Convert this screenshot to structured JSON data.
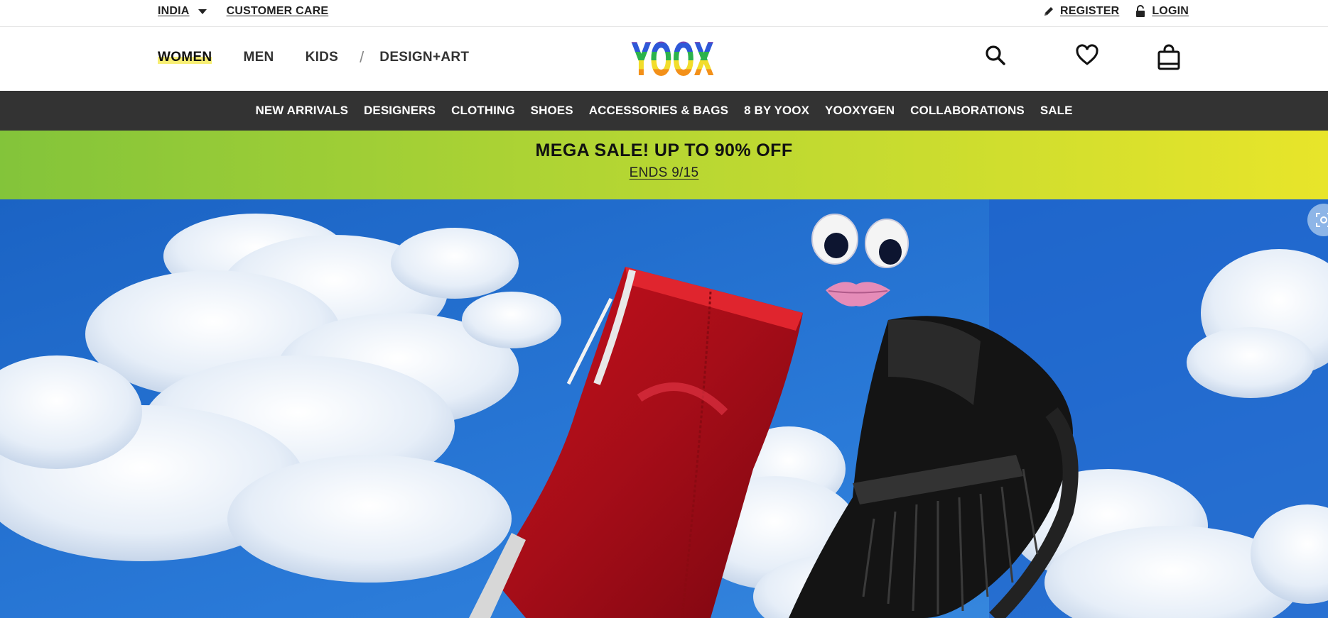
{
  "utility": {
    "country": "INDIA",
    "customer_care": "CUSTOMER CARE",
    "register": "REGISTER",
    "login": "LOGIN"
  },
  "header": {
    "gender_nav": [
      "WOMEN",
      "MEN",
      "KIDS",
      "DESIGN+ART"
    ],
    "active_gender": "WOMEN",
    "logo_text": "YOOX",
    "icons": [
      "search-icon",
      "heart-icon",
      "shopping-bag-icon"
    ]
  },
  "categories": [
    "NEW ARRIVALS",
    "DESIGNERS",
    "CLOTHING",
    "SHOES",
    "ACCESSORIES & BAGS",
    "8 BY YOOX",
    "YOOXYGEN",
    "COLLABORATIONS",
    "SALE"
  ],
  "promo": {
    "title": "MEGA SALE! UP TO 90% OFF",
    "subtitle": "ENDS 9/15"
  },
  "colors": {
    "category_bar": "#333333",
    "promo_gradient_start": "#83c43a",
    "promo_gradient_end": "#e8e52a",
    "active_highlight": "#f7ee73",
    "hero_sky": "#1f6fd0"
  }
}
